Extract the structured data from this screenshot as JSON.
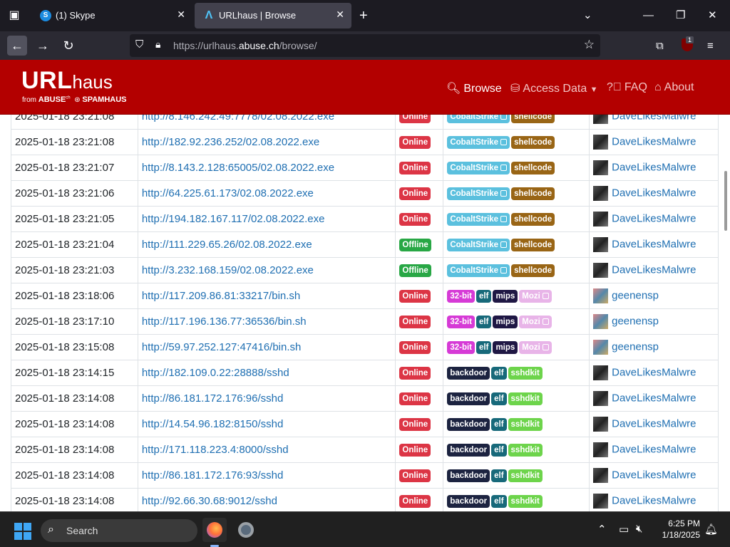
{
  "browser": {
    "tabs": [
      {
        "title": "(1) Skype",
        "icon": "skype-icon"
      },
      {
        "title": "URLhaus | Browse",
        "icon": "urlhaus-icon"
      }
    ],
    "url_prefix": "https://urlhaus.",
    "url_domain": "abuse.ch",
    "url_path": "/browse/"
  },
  "site": {
    "logo_main": "URL",
    "logo_rest": "haus",
    "logo_from": "from",
    "logo_abuse": "ABUSE",
    "logo_spamhaus": "SPAMHAUS",
    "nav": {
      "browse": "Browse",
      "access": "Access Data",
      "faq": "FAQ",
      "about": "About"
    }
  },
  "table": {
    "rows": [
      {
        "date": "2025-01-18 23:21:08",
        "url": "http://8.146.242.49:7778/02.08.2022.exe",
        "status": "Online",
        "tags": [
          "CobaltStrike",
          "shellcode"
        ],
        "reporter": "DaveLikesMalwre"
      },
      {
        "date": "2025-01-18 23:21:08",
        "url": "http://182.92.236.252/02.08.2022.exe",
        "status": "Online",
        "tags": [
          "CobaltStrike",
          "shellcode"
        ],
        "reporter": "DaveLikesMalwre"
      },
      {
        "date": "2025-01-18 23:21:07",
        "url": "http://8.143.2.128:65005/02.08.2022.exe",
        "status": "Online",
        "tags": [
          "CobaltStrike",
          "shellcode"
        ],
        "reporter": "DaveLikesMalwre"
      },
      {
        "date": "2025-01-18 23:21:06",
        "url": "http://64.225.61.173/02.08.2022.exe",
        "status": "Online",
        "tags": [
          "CobaltStrike",
          "shellcode"
        ],
        "reporter": "DaveLikesMalwre"
      },
      {
        "date": "2025-01-18 23:21:05",
        "url": "http://194.182.167.117/02.08.2022.exe",
        "status": "Online",
        "tags": [
          "CobaltStrike",
          "shellcode"
        ],
        "reporter": "DaveLikesMalwre"
      },
      {
        "date": "2025-01-18 23:21:04",
        "url": "http://111.229.65.26/02.08.2022.exe",
        "status": "Offline",
        "tags": [
          "CobaltStrike",
          "shellcode"
        ],
        "reporter": "DaveLikesMalwre"
      },
      {
        "date": "2025-01-18 23:21:03",
        "url": "http://3.232.168.159/02.08.2022.exe",
        "status": "Offline",
        "tags": [
          "CobaltStrike",
          "shellcode"
        ],
        "reporter": "DaveLikesMalwre"
      },
      {
        "date": "2025-01-18 23:18:06",
        "url": "http://117.209.86.81:33217/bin.sh",
        "status": "Online",
        "tags": [
          "32-bit",
          "elf",
          "mips",
          "Mozi"
        ],
        "reporter": "geenensp"
      },
      {
        "date": "2025-01-18 23:17:10",
        "url": "http://117.196.136.77:36536/bin.sh",
        "status": "Online",
        "tags": [
          "32-bit",
          "elf",
          "mips",
          "Mozi"
        ],
        "reporter": "geenensp"
      },
      {
        "date": "2025-01-18 23:15:08",
        "url": "http://59.97.252.127:47416/bin.sh",
        "status": "Online",
        "tags": [
          "32-bit",
          "elf",
          "mips",
          "Mozi"
        ],
        "reporter": "geenensp"
      },
      {
        "date": "2025-01-18 23:14:15",
        "url": "http://182.109.0.22:28888/sshd",
        "status": "Online",
        "tags": [
          "backdoor",
          "elf",
          "sshdkit"
        ],
        "reporter": "DaveLikesMalwre"
      },
      {
        "date": "2025-01-18 23:14:08",
        "url": "http://86.181.172.176:96/sshd",
        "status": "Online",
        "tags": [
          "backdoor",
          "elf",
          "sshdkit"
        ],
        "reporter": "DaveLikesMalwre"
      },
      {
        "date": "2025-01-18 23:14:08",
        "url": "http://14.54.96.182:8150/sshd",
        "status": "Online",
        "tags": [
          "backdoor",
          "elf",
          "sshdkit"
        ],
        "reporter": "DaveLikesMalwre"
      },
      {
        "date": "2025-01-18 23:14:08",
        "url": "http://171.118.223.4:8000/sshd",
        "status": "Online",
        "tags": [
          "backdoor",
          "elf",
          "sshdkit"
        ],
        "reporter": "DaveLikesMalwre"
      },
      {
        "date": "2025-01-18 23:14:08",
        "url": "http://86.181.172.176:93/sshd",
        "status": "Online",
        "tags": [
          "backdoor",
          "elf",
          "sshdkit"
        ],
        "reporter": "DaveLikesMalwre"
      },
      {
        "date": "2025-01-18 23:14:08",
        "url": "http://92.66.30.68:9012/sshd",
        "status": "Online",
        "tags": [
          "backdoor",
          "elf",
          "sshdkit"
        ],
        "reporter": "DaveLikesMalwre"
      }
    ]
  },
  "taskbar": {
    "search_label": "Search",
    "time": "6:25 PM",
    "date": "1/18/2025"
  },
  "colors": {
    "header": "#b30000",
    "link": "#1f6fb2",
    "online": "#dc3545",
    "offline": "#28a745"
  }
}
